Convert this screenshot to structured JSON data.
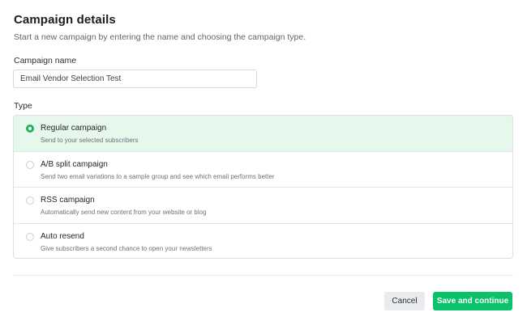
{
  "header": {
    "title": "Campaign details",
    "subtitle": "Start a new campaign by entering the name and choosing the campaign type."
  },
  "name_field": {
    "label": "Campaign name",
    "value": "Email Vendor Selection Test"
  },
  "type_section": {
    "label": "Type",
    "selected_index": 0,
    "options": [
      {
        "title": "Regular campaign",
        "description": "Send to your selected subscribers"
      },
      {
        "title": "A/B split campaign",
        "description": "Send two email variations to a sample group and see which email performs better"
      },
      {
        "title": "RSS campaign",
        "description": "Automatically send new content from your website or blog"
      },
      {
        "title": "Auto resend",
        "description": "Give subscribers a second chance to open your newsletters"
      }
    ]
  },
  "actions": {
    "cancel_label": "Cancel",
    "save_label": "Save and continue"
  },
  "colors": {
    "accent": "#09c269",
    "selected_bg": "#e6f7ec",
    "radio_selected": "#22b45c"
  }
}
